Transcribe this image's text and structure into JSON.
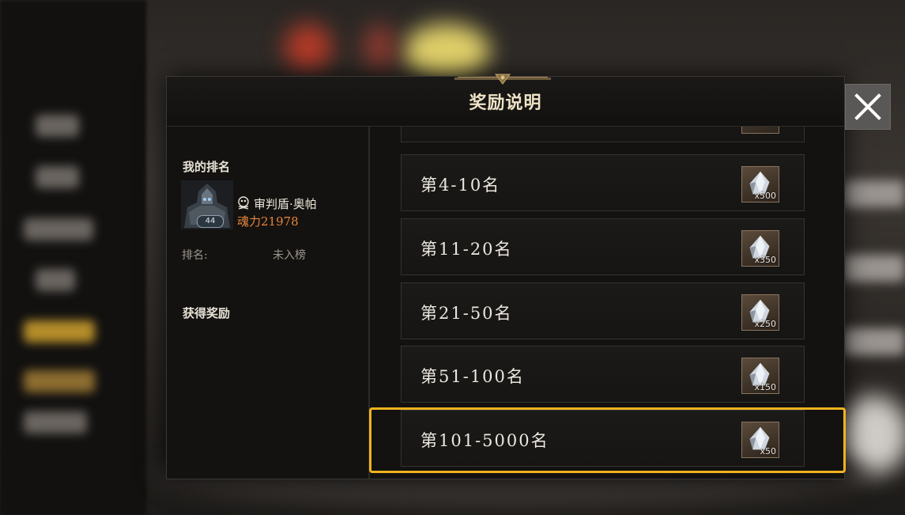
{
  "panel": {
    "title": "奖励说明",
    "close_icon": "close-icon"
  },
  "my_rank": {
    "heading": "我的排名",
    "player_name": "审判盾·奥帕",
    "level": "44",
    "power": "魂力21978",
    "rank_label": "排名:",
    "rank_value": "未入榜",
    "reward_heading": "获得奖励"
  },
  "tiers": [
    {
      "label": "第4-10名",
      "reward_icon": "diamond-icon",
      "qty": "x500"
    },
    {
      "label": "第11-20名",
      "reward_icon": "diamond-icon",
      "qty": "x350"
    },
    {
      "label": "第21-50名",
      "reward_icon": "diamond-icon",
      "qty": "x250"
    },
    {
      "label": "第51-100名",
      "reward_icon": "diamond-icon",
      "qty": "x150"
    },
    {
      "label": "第101-5000名",
      "reward_icon": "diamond-icon",
      "qty": "x50"
    }
  ],
  "colors": {
    "highlight": "#f1b21e",
    "power": "#e8853c"
  }
}
